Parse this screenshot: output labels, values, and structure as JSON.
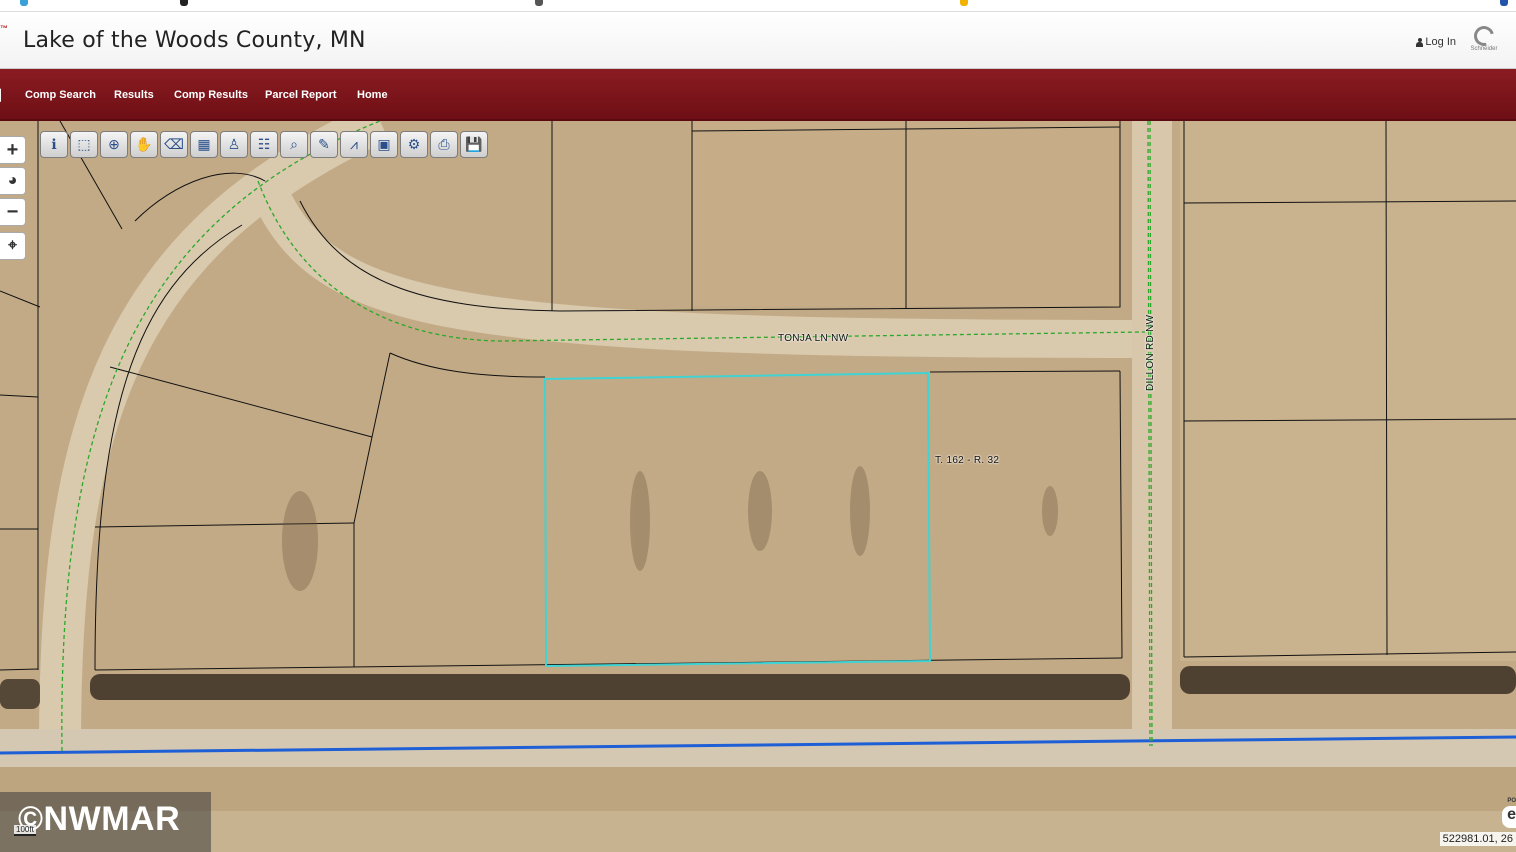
{
  "header": {
    "tm": "™",
    "title": "Lake of the Woods County, MN",
    "login_label": "Log In",
    "logo_text": "Schneider"
  },
  "nav": {
    "items": [
      "Comp Search",
      "Results",
      "Comp Results",
      "Parcel Report",
      "Home"
    ]
  },
  "toolbar": {
    "tools": [
      {
        "icon": "info-icon",
        "glyph": "ℹ"
      },
      {
        "icon": "select-icon",
        "glyph": "⬚"
      },
      {
        "icon": "zoom-in-icon",
        "glyph": "⊕"
      },
      {
        "icon": "pan-hand-icon",
        "glyph": "✋"
      },
      {
        "icon": "eraser-icon",
        "glyph": "⌫"
      },
      {
        "icon": "area-select-icon",
        "glyph": "▦"
      },
      {
        "icon": "pegman-icon",
        "glyph": "♙"
      },
      {
        "icon": "layers-icon",
        "glyph": "☷"
      },
      {
        "icon": "search-icon",
        "glyph": "⌕"
      },
      {
        "icon": "draw-pencil-icon",
        "glyph": "✎"
      },
      {
        "icon": "measure-icon",
        "glyph": "⩘"
      },
      {
        "icon": "map-view-icon",
        "glyph": "▣"
      },
      {
        "icon": "buffer-icon",
        "glyph": "⚙"
      },
      {
        "icon": "print-icon",
        "glyph": "⎙"
      },
      {
        "icon": "save-icon",
        "glyph": "💾"
      }
    ]
  },
  "zoom": {
    "zoom_in": "+",
    "globe": "◕",
    "zoom_out": "−",
    "locate": "⌖"
  },
  "map": {
    "road_label_1": "TONJA LN NW",
    "road_label_2": "DILLON RD NW",
    "township_label": "T. 162 - R. 32",
    "scale_label": "100ft",
    "coords": "522981.01, 26",
    "watermark": "©NWMAR",
    "powered_small": "PO",
    "powered_logo": "e"
  },
  "colors": {
    "nav_bg": "#7b141b",
    "parcel_line": "#111111",
    "selected_parcel": "#3fd3d3",
    "road_centerline": "#2aa82a",
    "highway_line": "#1f5fd6"
  }
}
